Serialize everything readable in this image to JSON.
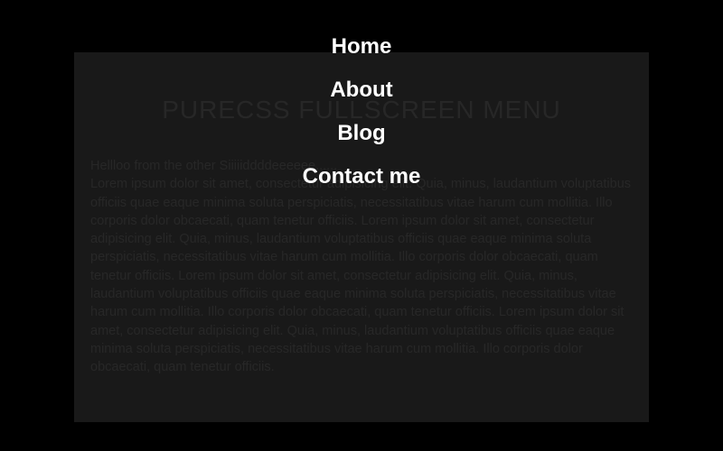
{
  "page": {
    "title": "PURECSS FULLSCREEN MENU",
    "greeting": "Hellloo from the other Siiiiiddddeeeeee......",
    "body": "Lorem ipsum dolor sit amet, consectetur adipisicing elit. Quia, minus, laudantium voluptatibus officiis quae eaque minima soluta perspiciatis, necessitatibus vitae harum cum mollitia. Illo corporis dolor obcaecati, quam tenetur officiis. Lorem ipsum dolor sit amet, consectetur adipisicing elit. Quia, minus, laudantium voluptatibus officiis quae eaque minima soluta perspiciatis, necessitatibus vitae harum cum mollitia. Illo corporis dolor obcaecati, quam tenetur officiis. Lorem ipsum dolor sit amet, consectetur adipisicing elit. Quia, minus, laudantium voluptatibus officiis quae eaque minima soluta perspiciatis, necessitatibus vitae harum cum mollitia. Illo corporis dolor obcaecati, quam tenetur officiis. Lorem ipsum dolor sit amet, consectetur adipisicing elit. Quia, minus, laudantium voluptatibus officiis quae eaque minima soluta perspiciatis, necessitatibus vitae harum cum mollitia. Illo corporis dolor obcaecati, quam tenetur officiis."
  },
  "menu": {
    "items": [
      {
        "label": "Home"
      },
      {
        "label": "About"
      },
      {
        "label": "Blog"
      },
      {
        "label": "Contact me"
      }
    ]
  }
}
